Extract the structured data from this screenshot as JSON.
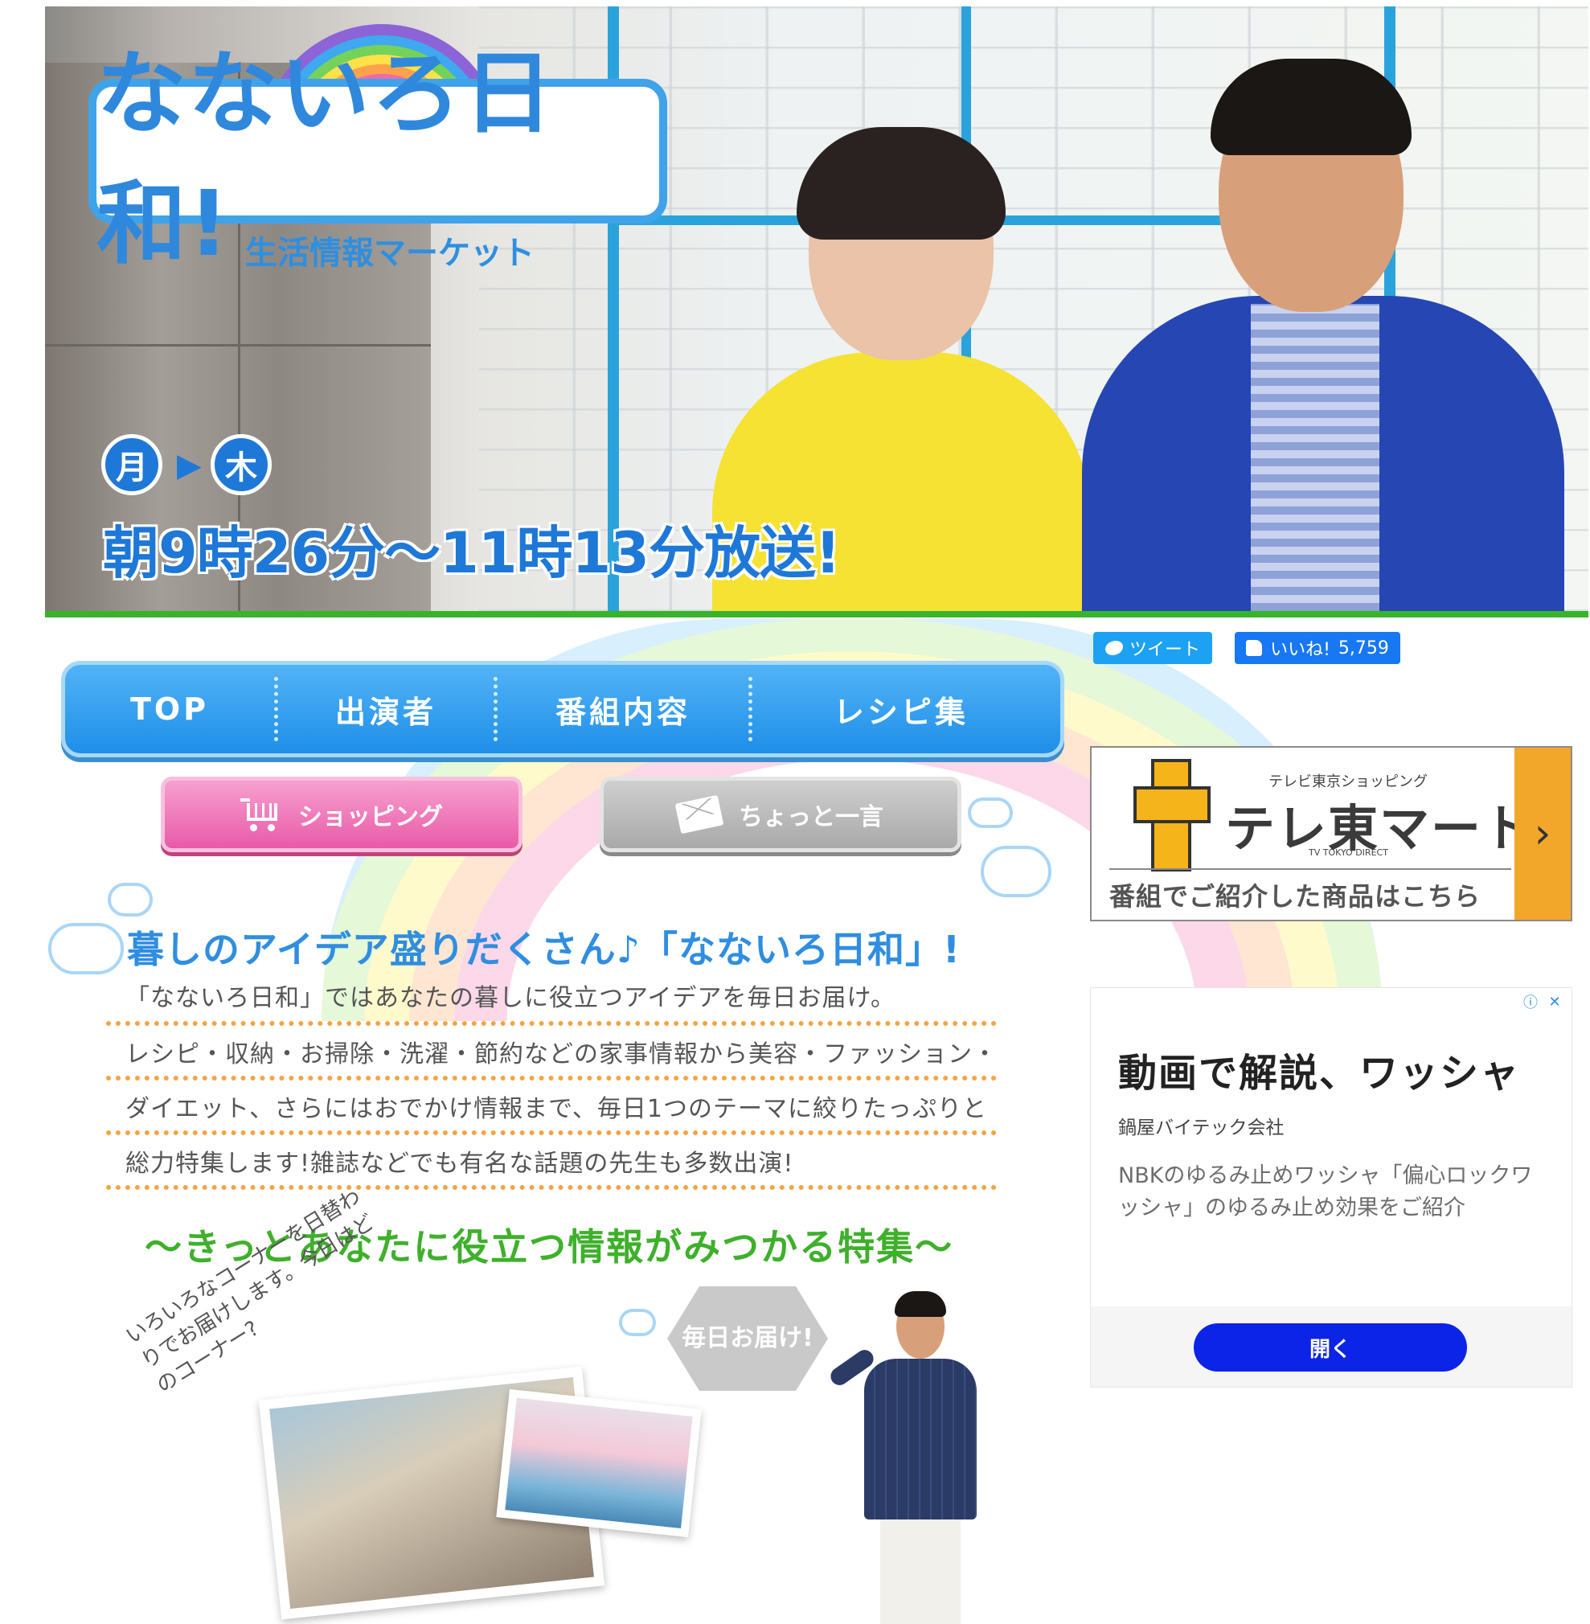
{
  "hero": {
    "logo_title": "なないろ日和!",
    "logo_subtitle": "生活情報マーケット",
    "day_start": "月",
    "day_arrow": "▶",
    "day_end": "木",
    "airtime": "朝9時26分〜11時13分放送!"
  },
  "nav": {
    "items": [
      {
        "label": "TOP"
      },
      {
        "label": "出演者"
      },
      {
        "label": "番組内容"
      },
      {
        "label": "レシピ集"
      }
    ],
    "shopping_label": "ショッピング",
    "comment_label": "ちょっと一言"
  },
  "intro": {
    "heading": "暮しのアイデア盛りだくさん♪「なないろ日和」!",
    "lines": [
      "「なないろ日和」ではあなたの暮しに役立つアイデアを毎日お届け。",
      "レシピ・収納・お掃除・洗濯・節約などの家事情報から美容・ファッション・",
      "ダイエット、さらにはおでかけ情報まで、毎日1つのテーマに絞りたっぷりと",
      "総力特集します!雑誌などでも有名な話題の先生も多数出演!"
    ],
    "feature_heading": "〜きっとあなたに役立つ情報がみつかる特集〜",
    "corner_text": "いろいろなコーナーを日替わりでお届けします。今日はどのコーナー?",
    "bubble_text": "毎日お届け!"
  },
  "social": {
    "tweet_label": "ツイート",
    "like_label": "いいね!",
    "like_count": "5,759"
  },
  "telemart": {
    "small": "テレビ東京ショッピング",
    "title": "テレ東マート",
    "en": "TV TOKYO DIRECT",
    "footer": "番組でご紹介した商品はこちら",
    "arrow": "›"
  },
  "ad": {
    "choices_info": "ⓘ",
    "choices_close": "✕",
    "headline": "動画で解説、ワッシャ",
    "advertiser": "鍋屋バイテック会社",
    "body": "NBKのゆるみ止めワッシャ「偏心ロックワッシャ」のゆるみ止め効果をご紹介",
    "open_label": "開く"
  }
}
